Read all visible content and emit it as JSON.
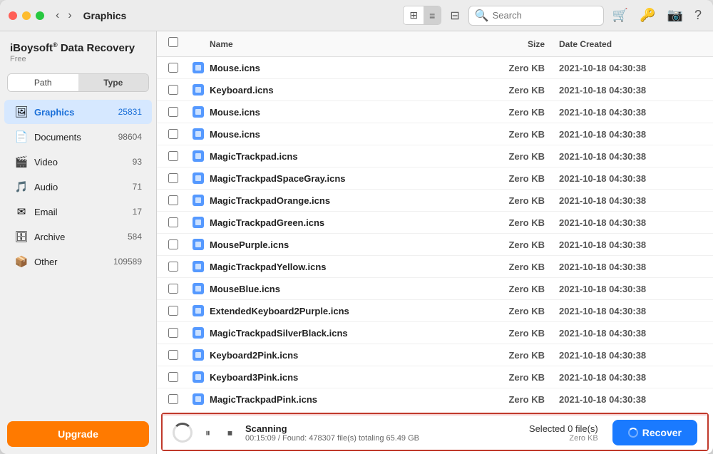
{
  "window": {
    "title": "Graphics"
  },
  "titlebar": {
    "back_btn": "‹",
    "forward_btn": "›",
    "breadcrumb": "Graphics",
    "search_placeholder": "Search",
    "grid_icon": "⊞",
    "list_icon": "≡",
    "filter_icon": "⊟",
    "cart_icon": "🛒",
    "key_icon": "🔑",
    "camera_icon": "📷",
    "help_icon": "?"
  },
  "app": {
    "title": "iBoysoft",
    "registered": "®",
    "product": "Data Recovery",
    "subtitle": "Free"
  },
  "sidebar": {
    "tab_path": "Path",
    "tab_type": "Type",
    "active_tab": "Type",
    "items": [
      {
        "id": "graphics",
        "label": "Graphics",
        "count": "25831",
        "active": true,
        "icon": "🖼"
      },
      {
        "id": "documents",
        "label": "Documents",
        "count": "98604",
        "active": false,
        "icon": "📄"
      },
      {
        "id": "video",
        "label": "Video",
        "count": "93",
        "active": false,
        "icon": "🎬"
      },
      {
        "id": "audio",
        "label": "Audio",
        "count": "71",
        "active": false,
        "icon": "🎵"
      },
      {
        "id": "email",
        "label": "Email",
        "count": "17",
        "active": false,
        "icon": "✉"
      },
      {
        "id": "archive",
        "label": "Archive",
        "count": "584",
        "active": false,
        "icon": "🗄"
      },
      {
        "id": "other",
        "label": "Other",
        "count": "109589",
        "active": false,
        "icon": "📦"
      }
    ],
    "upgrade_label": "Upgrade"
  },
  "table": {
    "col_name": "Name",
    "col_size": "Size",
    "col_date": "Date Created",
    "rows": [
      {
        "name": "Mouse.icns",
        "size": "Zero KB",
        "date": "2021-10-18 04:30:38"
      },
      {
        "name": "Keyboard.icns",
        "size": "Zero KB",
        "date": "2021-10-18 04:30:38"
      },
      {
        "name": "Mouse.icns",
        "size": "Zero KB",
        "date": "2021-10-18 04:30:38"
      },
      {
        "name": "Mouse.icns",
        "size": "Zero KB",
        "date": "2021-10-18 04:30:38"
      },
      {
        "name": "MagicTrackpad.icns",
        "size": "Zero KB",
        "date": "2021-10-18 04:30:38"
      },
      {
        "name": "MagicTrackpadSpaceGray.icns",
        "size": "Zero KB",
        "date": "2021-10-18 04:30:38"
      },
      {
        "name": "MagicTrackpadOrange.icns",
        "size": "Zero KB",
        "date": "2021-10-18 04:30:38"
      },
      {
        "name": "MagicTrackpadGreen.icns",
        "size": "Zero KB",
        "date": "2021-10-18 04:30:38"
      },
      {
        "name": "MousePurple.icns",
        "size": "Zero KB",
        "date": "2021-10-18 04:30:38"
      },
      {
        "name": "MagicTrackpadYellow.icns",
        "size": "Zero KB",
        "date": "2021-10-18 04:30:38"
      },
      {
        "name": "MouseBlue.icns",
        "size": "Zero KB",
        "date": "2021-10-18 04:30:38"
      },
      {
        "name": "ExtendedKeyboard2Purple.icns",
        "size": "Zero KB",
        "date": "2021-10-18 04:30:38"
      },
      {
        "name": "MagicTrackpadSilverBlack.icns",
        "size": "Zero KB",
        "date": "2021-10-18 04:30:38"
      },
      {
        "name": "Keyboard2Pink.icns",
        "size": "Zero KB",
        "date": "2021-10-18 04:30:38"
      },
      {
        "name": "Keyboard3Pink.icns",
        "size": "Zero KB",
        "date": "2021-10-18 04:30:38"
      },
      {
        "name": "MagicTrackpadPink.icns",
        "size": "Zero KB",
        "date": "2021-10-18 04:30:38"
      }
    ]
  },
  "status": {
    "scan_title": "Scanning",
    "scan_detail": "00:15:09 / Found: 478307 file(s) totaling 65.49 GB",
    "selected_files": "Selected 0 file(s)",
    "selected_size": "Zero KB",
    "recover_label": "Recover"
  }
}
